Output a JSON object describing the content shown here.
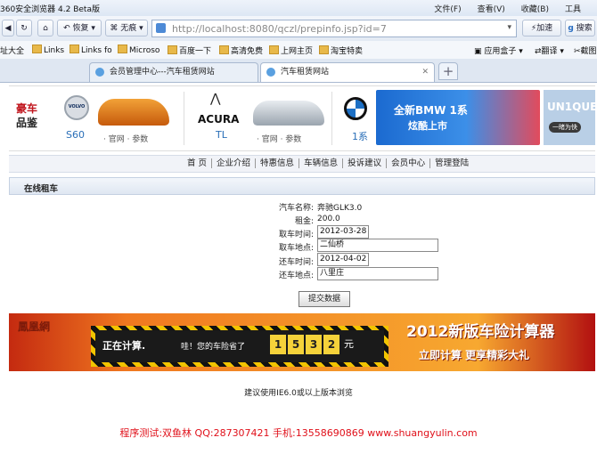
{
  "browser": {
    "title": "360安全浏览器 4.2 Beta版",
    "menu": [
      "文件(F)",
      "查看(V)",
      "收藏(B)",
      "工具"
    ],
    "nav": {
      "back_menu": "恢复",
      "mode": "无痕",
      "accelerate": "加速",
      "search_hint": "搜索"
    },
    "address": {
      "url": "http://localhost:8080/qczl/prepinfo.jsp?id=7"
    },
    "bookmarks": [
      "址大全",
      "Links",
      "Links fo",
      "Microso",
      "百度一下",
      "高清免费",
      "上网主页",
      "淘宝特卖",
      "应用盒子",
      "翻译",
      "截图"
    ],
    "tabs": [
      {
        "label": "会员管理中心---汽车租赁网站",
        "active": false
      },
      {
        "label": "汽车租赁网站",
        "active": true
      }
    ],
    "new_tab": "+"
  },
  "banner": {
    "left_title": [
      "豪车",
      "品鉴"
    ],
    "items": [
      {
        "brand": "VOLVO",
        "model": "S60",
        "links": "· 官网 · 参数"
      },
      {
        "brand": "ACURA",
        "model": "TL",
        "links": "· 官网 · 参数"
      },
      {
        "brand": "BMW",
        "model": "1系"
      }
    ],
    "promo": {
      "headline": "全新BMW 1系",
      "sub": "炫酷上市"
    },
    "right_promo": {
      "headline": "UN1QUE",
      "button": "一睹为快"
    }
  },
  "site_nav": [
    "首 页",
    "企业介绍",
    "特惠信息",
    "车辆信息",
    "投诉建议",
    "会员中心",
    "管理登陆"
  ],
  "section": {
    "title": "在线租车"
  },
  "form": {
    "car_name_label": "汽车名称:",
    "car_name": "奔驰GLK3.0",
    "rent_label": "租金:",
    "rent": "200.0",
    "pickup_time_label": "取车时间:",
    "pickup_time": "2012-03-28",
    "pickup_place_label": "取车地点:",
    "pickup_place": "二仙桥",
    "return_time_label": "还车时间:",
    "return_time": "2012-04-02",
    "return_place_label": "还车地点:",
    "return_place": "八里庄",
    "submit": "提交数据"
  },
  "ad": {
    "logo": "鳳凰網",
    "calc_text": "正在计算.",
    "saving_text": "哇！您的车险省了",
    "digits": [
      "1",
      "5",
      "3",
      "2"
    ],
    "unit": "元",
    "headline": "2012新版车险计算器",
    "cta": "立即计算 更享精彩大礼"
  },
  "footer_note": "建议使用IE6.0或以上版本浏览",
  "credit": "程序测试:双鱼林 QQ:287307421 手机:13558690869 www.shuangyulin.com"
}
